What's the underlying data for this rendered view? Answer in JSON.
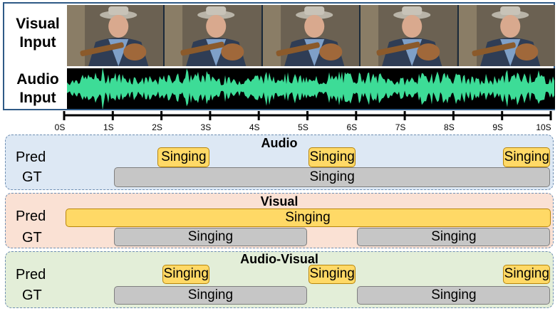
{
  "input": {
    "visual_label_1": "Visual",
    "visual_label_2": "Input",
    "audio_label_1": "Audio",
    "audio_label_2": "Input"
  },
  "timeline": {
    "ticks": [
      "0S",
      "1S",
      "2S",
      "3S",
      "4S",
      "5S",
      "6S",
      "7S",
      "8S",
      "9S",
      "10S"
    ]
  },
  "panels": [
    {
      "title": "Audio",
      "pred_label": "Pred",
      "gt_label": "GT",
      "pred_segments": [
        {
          "label": "Singing",
          "start": 1.9,
          "end": 3.0
        },
        {
          "label": "Singing",
          "start": 5.0,
          "end": 6.0
        },
        {
          "label": "Singing",
          "start": 9.0,
          "end": 10.0
        }
      ],
      "gt_segments": [
        {
          "label": "Singing",
          "start": 1.0,
          "end": 10.0
        }
      ]
    },
    {
      "title": "Visual",
      "pred_label": "Pred",
      "gt_label": "GT",
      "pred_segments": [
        {
          "label": "Singing",
          "start": 0.0,
          "end": 10.0
        }
      ],
      "gt_segments": [
        {
          "label": "Singing",
          "start": 1.0,
          "end": 5.0
        },
        {
          "label": "Singing",
          "start": 6.0,
          "end": 10.0
        }
      ]
    },
    {
      "title": "Audio-Visual",
      "pred_label": "Pred",
      "gt_label": "GT",
      "pred_segments": [
        {
          "label": "Singing",
          "start": 2.0,
          "end": 3.0
        },
        {
          "label": "Singing",
          "start": 5.0,
          "end": 6.0
        },
        {
          "label": "Singing",
          "start": 9.0,
          "end": 10.0
        }
      ],
      "gt_segments": [
        {
          "label": "Singing",
          "start": 1.0,
          "end": 5.0
        },
        {
          "label": "Singing",
          "start": 6.0,
          "end": 10.0
        }
      ]
    }
  ],
  "colors": {
    "pred_fill": "#ffd966",
    "gt_fill": "#c6c6c6",
    "audio_wave": "#3ddc97",
    "audio_panel_bg": "#dde8f4",
    "visual_panel_bg": "#fae1d4",
    "audiovisual_panel_bg": "#e3eed8",
    "frame_border": "#2f5a86"
  }
}
